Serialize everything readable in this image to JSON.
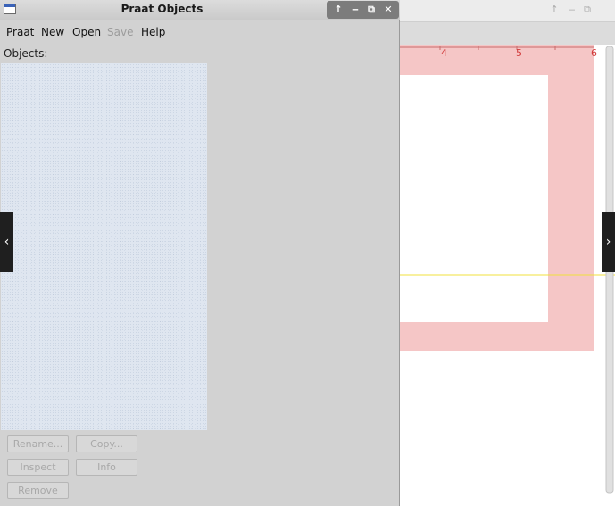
{
  "window": {
    "title": "Praat Objects"
  },
  "title_controls": {
    "up_icon": "↑",
    "minimize_icon": "‒",
    "restore_icon": "⧉",
    "close_icon": "✕"
  },
  "menu": {
    "items": [
      {
        "label": "Praat",
        "enabled": true
      },
      {
        "label": "New",
        "enabled": true
      },
      {
        "label": "Open",
        "enabled": true
      },
      {
        "label": "Save",
        "enabled": false
      },
      {
        "label": "Help",
        "enabled": true
      }
    ]
  },
  "objects": {
    "label": "Objects:",
    "items": []
  },
  "buttons": {
    "rename": "Rename...",
    "copy": "Copy...",
    "inspect": "Inspect",
    "info": "Info",
    "remove": "Remove"
  },
  "background_window": {
    "controls": {
      "up_icon": "↑",
      "minimize_icon": "‒",
      "restore_icon": "⧉"
    },
    "ruler_labels": [
      "4",
      "5",
      "6"
    ]
  },
  "nav": {
    "prev_icon": "‹",
    "next_icon": "›"
  },
  "colors": {
    "ruler_text": "#d23a3a",
    "pink_region": "#f5c6c6",
    "yellow_line": "#f0e03c",
    "objects_list_bg": "#dfe6f0"
  }
}
